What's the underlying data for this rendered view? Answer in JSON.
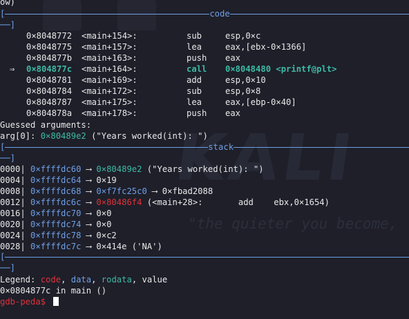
{
  "top_fragment": "ow)",
  "code": {
    "title": "code",
    "bracket_open": "[",
    "bracket_close": "──]",
    "rows": [
      {
        "marker": "",
        "addr": "0×8048772",
        "sym": "<main+154>:",
        "op": "sub",
        "args": "esp,0×c",
        "current": false
      },
      {
        "marker": "",
        "addr": "0×8048775",
        "sym": "<main+157>:",
        "op": "lea",
        "args": "eax,[ebx-0×1366]",
        "current": false
      },
      {
        "marker": "",
        "addr": "0×804877b",
        "sym": "<main+163>:",
        "op": "push",
        "args": "eax",
        "current": false
      },
      {
        "marker": "⇒",
        "addr": "0×804877c",
        "sym": "<main+164>:",
        "op": "call",
        "args": "0×8048480 <printf@plt>",
        "current": true
      },
      {
        "marker": "",
        "addr": "0×8048781",
        "sym": "<main+169>:",
        "op": "add",
        "args": "esp,0×10",
        "current": false
      },
      {
        "marker": "",
        "addr": "0×8048784",
        "sym": "<main+172>:",
        "op": "sub",
        "args": "esp,0×8",
        "current": false
      },
      {
        "marker": "",
        "addr": "0×8048787",
        "sym": "<main+175>:",
        "op": "lea",
        "args": "eax,[ebp-0×40]",
        "current": false
      },
      {
        "marker": "",
        "addr": "0×804878a",
        "sym": "<main+178>:",
        "op": "push",
        "args": "eax",
        "current": false
      }
    ],
    "guessed_label": "Guessed arguments:",
    "arg_label": "arg[0]: ",
    "arg_addr": "0×80489e2",
    "arg_text": " (\"Years worked(int): \")"
  },
  "stack": {
    "title": "stack",
    "bracket_open": "[",
    "bracket_close": "──]",
    "rows": [
      {
        "offset": "0000|",
        "addr": "0×ffffdc60",
        "arrow": " ⟶ ",
        "val": "0×80489e2",
        "val_color": "green",
        "rest": " (\"Years worked(int): \")"
      },
      {
        "offset": "0004|",
        "addr": "0×ffffdc64",
        "arrow": " ⟶ ",
        "val": "0×19",
        "val_color": "plain",
        "rest": ""
      },
      {
        "offset": "0008|",
        "addr": "0×ffffdc68",
        "arrow": " ⟶ ",
        "val": "0×f7fc25c0",
        "val_color": "blue",
        "rest": " ⟶ 0×fbad2088"
      },
      {
        "offset": "0012|",
        "addr": "0×ffffdc6c",
        "arrow": " ⟶ ",
        "val": "0×80486f4",
        "val_color": "red",
        "rest": " (<main+28>:       add    ebx,0×1654)"
      },
      {
        "offset": "0016|",
        "addr": "0×ffffdc70",
        "arrow": " ⟶ ",
        "val": "0×0",
        "val_color": "plain",
        "rest": ""
      },
      {
        "offset": "0020|",
        "addr": "0×ffffdc74",
        "arrow": " ⟶ ",
        "val": "0×0",
        "val_color": "plain",
        "rest": ""
      },
      {
        "offset": "0024|",
        "addr": "0×ffffdc78",
        "arrow": " ⟶ ",
        "val": "0×c2",
        "val_color": "plain",
        "rest": ""
      },
      {
        "offset": "0028|",
        "addr": "0×ffffdc7c",
        "arrow": " ⟶ ",
        "val": "0×414e",
        "val_color": "plain",
        "rest": " ('NA')"
      }
    ]
  },
  "footer": {
    "bracket_open": "[",
    "bracket_close": "──]",
    "legend_label": "Legend: ",
    "legend_code": "code",
    "legend_data": "data",
    "legend_rodata": "rodata",
    "legend_value": "value",
    "sep": ", ",
    "location": "0×0804877c in main ()",
    "prompt": "gdb-peda$ "
  },
  "colors": {
    "background": "#1e1f29",
    "code": "#e0313a",
    "data": "#6f9fe6",
    "rodata": "#3fb9a5",
    "value": "#e8e8e8"
  }
}
